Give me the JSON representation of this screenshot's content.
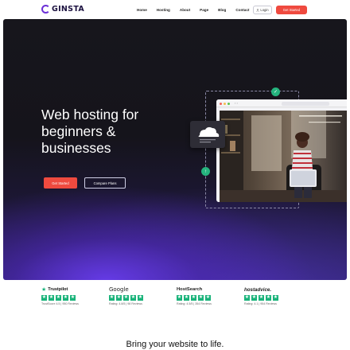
{
  "nav": {
    "logo_text": "GINSTA",
    "menu": [
      "Home",
      "Hosting",
      "About",
      "Page",
      "Blog",
      "Contact"
    ],
    "login_label": "Login",
    "cta_label": "Get Started"
  },
  "hero": {
    "title": "Web hosting for beginners & businesses",
    "cta_primary": "Get Started",
    "cta_secondary": "Compare Plans"
  },
  "reviews": [
    {
      "brand": "Trustpilot",
      "stars": 5,
      "caption": "TrustScore 4.5 | 950 Reviews"
    },
    {
      "brand": "Google",
      "stars": 5,
      "caption": "Rating: 4.8/5 | 98 Reviews"
    },
    {
      "brand": "HostSearch",
      "stars": 5,
      "caption": "Rating: 4.5/5 | 354 Reviews"
    },
    {
      "brand": "hostadvice.",
      "stars": 5,
      "caption": "Rating: 4.1 | 954 Reviews"
    }
  ],
  "section_heading": "Bring your website to life.",
  "colors": {
    "accent": "#ef4a3f",
    "brand": "#6b2fd6",
    "star": "#19b37a"
  }
}
